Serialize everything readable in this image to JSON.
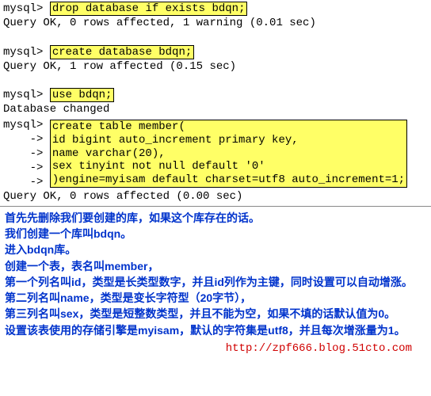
{
  "term": {
    "p": "mysql>",
    "c1": "drop database if exists bdqn;",
    "r1": "Query OK, 0 rows affected, 1 warning (0.01 sec)",
    "c2": "create database bdqn;",
    "r2": "Query OK, 1 row affected (0.15 sec)",
    "c3": "use bdqn;",
    "r3": "Database changed",
    "arrow": "    ->",
    "ct1": "create table member(",
    "ct2": "id bigint auto_increment primary key,",
    "ct3": "name varchar(20),",
    "ct4": "sex tinyint not null default '0'",
    "ct5": ")engine=myisam default charset=utf8 auto_increment=1;",
    "r4": "Query OK, 0 rows affected (0.00 sec)"
  },
  "explain": {
    "l1": "首先先删除我们要创建的库，如果这个库存在的话。",
    "l2": "我们创建一个库叫bdqn。",
    "l3": "进入bdqn库。",
    "l4": "创建一个表，表名叫member，",
    "l5": "第一个列名叫id，类型是长类型数字，并且id列作为主键，同时设置可以自动增涨。",
    "l6": "第二列名叫name，类型是变长字符型（20字节），",
    "l7": "第三列名叫sex，类型是短整数类型，并且不能为空，如果不填的话默认值为0。",
    "l8": "设置该表使用的存储引擎是myisam，默认的字符集是utf8，并且每次增涨量为1。"
  },
  "footer": "http://zpf666.blog.51cto.com"
}
